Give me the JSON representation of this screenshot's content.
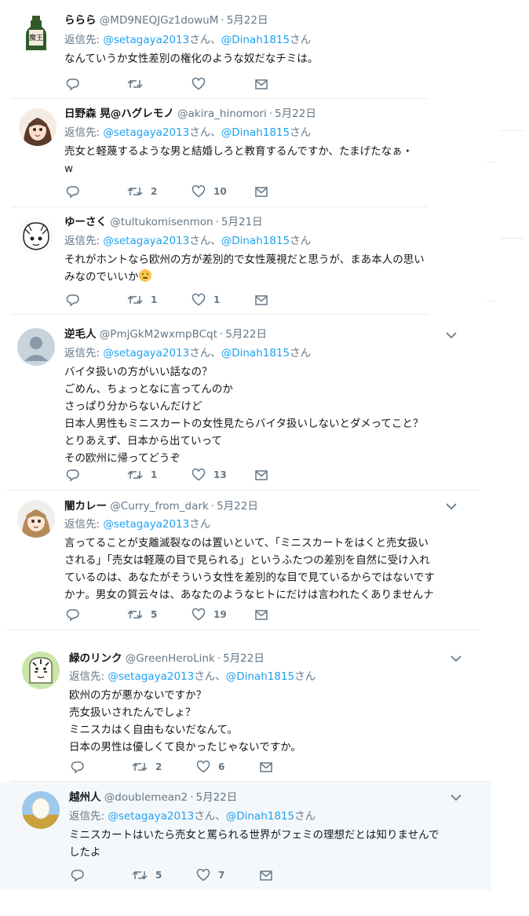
{
  "reply_prefix": "返信先: ",
  "reply_joiner": "さん、",
  "reply_suffix": "さん",
  "tweets": [
    {
      "name": "ららら",
      "handle": "@MD9NEQJGz1dowuM",
      "date": "5月22日",
      "mentions": [
        "@setagaya2013",
        "@Dinah1815"
      ],
      "lines": [
        "なんていうか女性差別の権化のような奴だなチミは。"
      ],
      "reply_count": "",
      "retweet_count": "",
      "like_count": "",
      "avatar": "sake-bottle"
    },
    {
      "name": "日野森 晃@ハグレモノ",
      "handle": "@akira_hinomori",
      "date": "5月22日",
      "mentions": [
        "@setagaya2013",
        "@Dinah1815"
      ],
      "lines": [
        "売女と軽蔑するような男と結婚しろと教育するんですか、たまげたなぁ・",
        "w"
      ],
      "reply_count": "",
      "retweet_count": "2",
      "like_count": "10",
      "avatar": "anime-girl"
    },
    {
      "name": "ゆーさく",
      "handle": "@tultukomisenmon",
      "date": "5月21日",
      "mentions": [
        "@setagaya2013",
        "@Dinah1815"
      ],
      "lines": [
        "それがホントなら欧州の方が差別的で女性蔑視だと思うが、まあ本人の思い",
        "みなのでいいか"
      ],
      "emoji": "thinking-face",
      "reply_count": "",
      "retweet_count": "1",
      "like_count": "1",
      "avatar": "sketch-face"
    },
    {
      "name": "逆毛人",
      "handle": "@PmjGkM2wxmpBCqt",
      "date": "5月22日",
      "mentions": [
        "@setagaya2013",
        "@Dinah1815"
      ],
      "lines": [
        "バイタ扱いの方がいい話なの？",
        "ごめん、ちょっとなに言ってんのか",
        "さっぱり分からないんだけど",
        "日本人男性もミニスカートの女性見たらバイタ扱いしないとダメってこと？",
        "とりあえず、日本から出ていって",
        "その欧州に帰ってどうぞ"
      ],
      "reply_count": "",
      "retweet_count": "1",
      "like_count": "13",
      "avatar": "default-egg"
    },
    {
      "name": "闇カレー",
      "handle": "@Curry_from_dark",
      "date": "5月22日",
      "mentions": [
        "@setagaya2013"
      ],
      "lines": [
        "言ってることが支離滅裂なのは置いといて、「ミニスカートをはくと売女扱い",
        "される」「売女は軽蔑の目で見られる」というふたつの差別を自然に受け入れ",
        "ているのは、あなたがそういう女性を差別的な目で見ているからではないです",
        "かナ。男女の質云々は、あなたのようなヒトにだけは言われたくありませんナ"
      ],
      "reply_count": "",
      "retweet_count": "5",
      "like_count": "19",
      "avatar": "anime-girl-2"
    },
    {
      "name": "緑のリンク",
      "handle": "@GreenHeroLink",
      "date": "5月22日",
      "mentions": [
        "@setagaya2013",
        "@Dinah1815"
      ],
      "lines": [
        "欧州の方が悪かないですか？",
        "売女扱いされたんでしょ？",
        "ミニスカはく自由もないだなんて。",
        "日本の男性は優しくて良かったじゃないですか。"
      ],
      "reply_count": "",
      "retweet_count": "2",
      "like_count": "6",
      "avatar": "tiger-mask"
    },
    {
      "name": "越州人",
      "handle": "@doublemean2",
      "date": "5月22日",
      "mentions": [
        "@setagaya2013",
        "@Dinah1815"
      ],
      "lines": [
        "ミニスカートはいたら売女と罵られる世界がフェミの理想だとは知りませんで",
        "したよ"
      ],
      "reply_count": "",
      "retweet_count": "5",
      "like_count": "7",
      "avatar": "egg-field"
    }
  ],
  "colors": {
    "accent": "#1da1f2",
    "muted": "#657786",
    "border": "#e6ecf0",
    "highlight_bg": "#f5f8fa"
  }
}
